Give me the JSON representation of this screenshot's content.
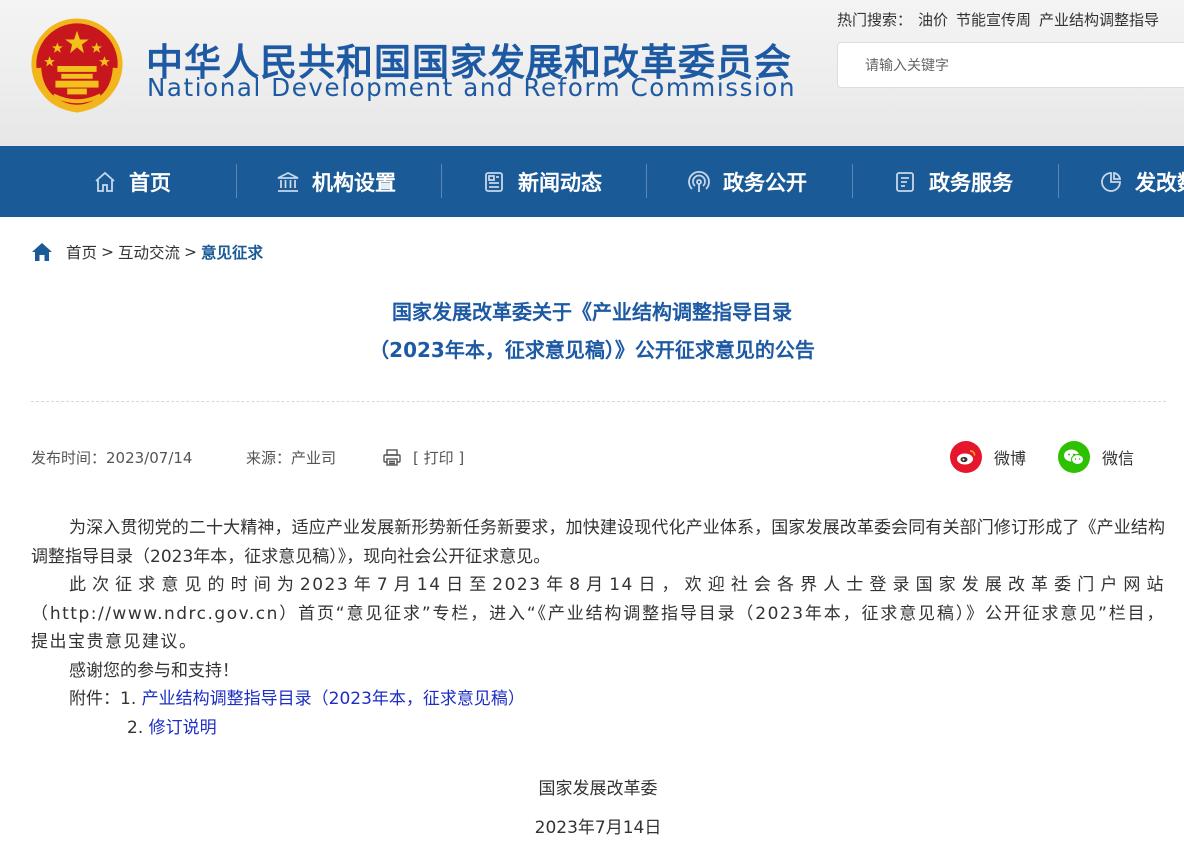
{
  "header": {
    "title_cn": "中华人民共和国国家发展和改革委员会",
    "title_en": "National Development and Reform Commission",
    "hot_search_label": "热门搜索：",
    "hot_search_items": [
      "油价",
      "节能宣传周",
      "产业结构调整指导"
    ],
    "search_placeholder": "请输入关键字"
  },
  "nav": {
    "items": [
      {
        "label": "首页",
        "icon": "home-icon"
      },
      {
        "label": "机构设置",
        "icon": "building-icon"
      },
      {
        "label": "新闻动态",
        "icon": "newspaper-icon"
      },
      {
        "label": "政务公开",
        "icon": "broadcast-icon"
      },
      {
        "label": "政务服务",
        "icon": "document-icon"
      },
      {
        "label": "发改数",
        "icon": "pie-chart-icon"
      }
    ]
  },
  "breadcrumb": {
    "items": [
      "首页",
      "互动交流",
      "意见征求"
    ],
    "separator": ">"
  },
  "article": {
    "title_line1": "国家发展改革委关于《产业结构调整指导目录",
    "title_line2": "（2023年本，征求意见稿）》公开征求意见的公告",
    "publish_label": "发布时间：2023/07/14",
    "source_label": "来源：产业司",
    "print_label": "[ 打印 ]",
    "share": {
      "weibo": "微博",
      "wechat": "微信"
    },
    "paragraphs": [
      "为深入贯彻党的二十大精神，适应产业发展新形势新任务新要求，加快建设现代化产业体系，国家发展改革委会同有关部门修订形成了《产业结构调整指导目录（2023年本，征求意见稿）》，现向社会公开征求意见。",
      "此次征求意见的时间为2023年7月14日至2023年8月14日，欢迎社会各界人士登录国家发展改革委门户网站（http://www.ndrc.gov.cn）首页“意见征求”专栏，进入“《产业结构调整指导目录（2023年本，征求意见稿）》公开征求意见”栏目，提出宝贵意见建议。",
      "感谢您的参与和支持！"
    ],
    "attachments_label": "附件：",
    "attachments": [
      {
        "number": "1.",
        "label": "产业结构调整指导目录（2023年本，征求意见稿）"
      },
      {
        "number": "2.",
        "label": "修订说明"
      }
    ],
    "signature": "国家发展改革委",
    "date": "2023年7月14日"
  },
  "colors": {
    "nav_bg": "#1a5a96",
    "title_blue": "#1d5aa3",
    "link_blue": "#1d2ec4",
    "weibo_red": "#e6162d",
    "wechat_green": "#2dc100"
  }
}
